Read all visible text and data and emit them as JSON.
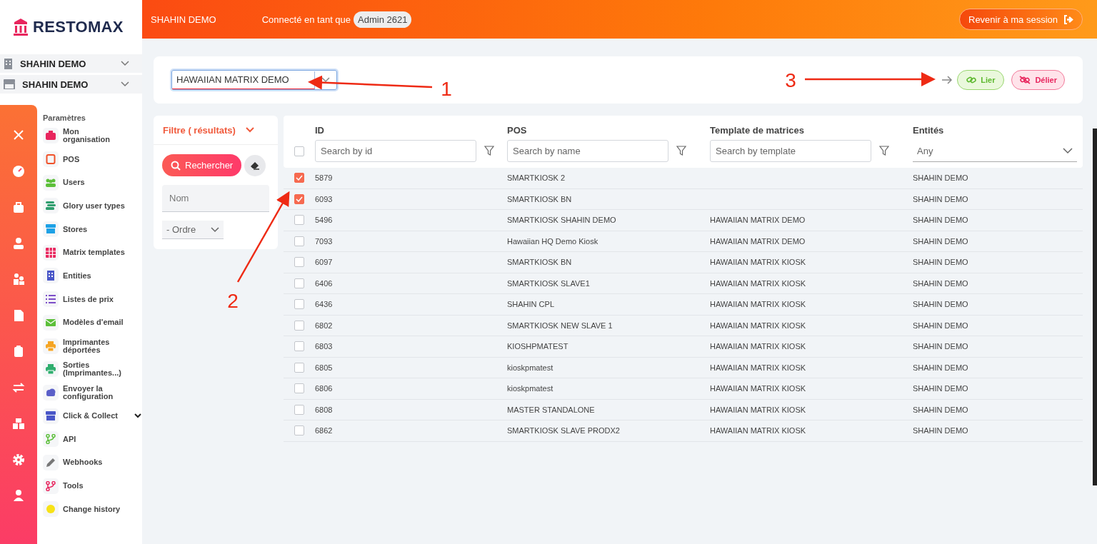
{
  "brand": {
    "name": "RESTOMAX"
  },
  "header": {
    "org": "SHAHIN DEMO",
    "connected_label": "Connecté en tant que",
    "user": "Admin 2621",
    "return_button": "Revenir à ma session"
  },
  "org_selectors": [
    {
      "kind": "building",
      "label": "SHAHIN DEMO"
    },
    {
      "kind": "store",
      "label": "SHAHIN DEMO"
    }
  ],
  "rail": [
    {
      "kind": "close"
    },
    {
      "kind": "gauge"
    },
    {
      "kind": "bag"
    },
    {
      "kind": "person"
    },
    {
      "kind": "people"
    },
    {
      "kind": "document"
    },
    {
      "kind": "clipboard"
    },
    {
      "kind": "swap"
    },
    {
      "kind": "boxes"
    },
    {
      "kind": "gear"
    },
    {
      "kind": "user"
    }
  ],
  "menu": {
    "title": "Paramètres",
    "items": [
      {
        "kind": "briefcase",
        "label": "Mon organisation",
        "color": "#e8265e"
      },
      {
        "kind": "tablet",
        "label": "POS",
        "color": "#f0522a"
      },
      {
        "kind": "people",
        "label": "Users",
        "color": "#5cbf3a"
      },
      {
        "kind": "coins",
        "label": "Glory user types",
        "color": "#2f9e6e"
      },
      {
        "kind": "store",
        "label": "Stores",
        "color": "#1da1e6"
      },
      {
        "kind": "grid",
        "label": "Matrix templates",
        "color": "#e8265e"
      },
      {
        "kind": "building",
        "label": "Entities",
        "color": "#4a57c8"
      },
      {
        "kind": "list",
        "label": "Listes de prix",
        "color": "#7c4dc8"
      },
      {
        "kind": "envelope",
        "label": "Modèles d'email",
        "color": "#5cbf3a"
      },
      {
        "kind": "printer",
        "label": "Imprimantes déportées",
        "color": "#f5a524"
      },
      {
        "kind": "printer",
        "label": "Sorties (Imprimantes...)",
        "color": "#2fae6e"
      },
      {
        "kind": "cloud",
        "label": "Envoyer la configuration",
        "color": "#5a5fc8"
      },
      {
        "kind": "store",
        "label": "Click & Collect",
        "color": "#4a57c8",
        "expandable": true
      },
      {
        "kind": "branch",
        "label": "API",
        "color": "#5cbf3a"
      },
      {
        "kind": "pencil",
        "label": "Webhooks",
        "color": "#777777"
      },
      {
        "kind": "branch",
        "label": "Tools",
        "color": "#e8265e"
      },
      {
        "kind": "dot",
        "label": "Change history",
        "color": "#f7e217"
      }
    ]
  },
  "template_select": {
    "value": "HAWAIIAN MATRIX DEMO"
  },
  "actions": {
    "link": "Lier",
    "unlink": "Délier"
  },
  "filter": {
    "title": "Filtre ( résultats)",
    "search_button": "Rechercher",
    "name_placeholder": "Nom",
    "order": "- Ordre"
  },
  "table": {
    "columns": [
      "ID",
      "POS",
      "Template de matrices",
      "Entités"
    ],
    "filters": [
      {
        "placeholder": "Search by id"
      },
      {
        "placeholder": "Search by name"
      },
      {
        "placeholder": "Search by template"
      },
      {
        "value": "Any"
      }
    ],
    "all_selected": false,
    "rows": [
      {
        "selected": true,
        "id": "5879",
        "pos": "SMARTKIOSK 2",
        "template": "",
        "entity": "SHAHIN DEMO"
      },
      {
        "selected": true,
        "id": "6093",
        "pos": "SMARTKIOSK BN",
        "template": "",
        "entity": "SHAHIN DEMO"
      },
      {
        "selected": false,
        "id": "5496",
        "pos": "SMARTKIOSK SHAHIN DEMO",
        "template": "HAWAIIAN MATRIX DEMO",
        "entity": "SHAHIN DEMO"
      },
      {
        "selected": false,
        "id": "7093",
        "pos": "Hawaiian HQ Demo Kiosk",
        "template": "HAWAIIAN MATRIX DEMO",
        "entity": "SHAHIN DEMO"
      },
      {
        "selected": false,
        "id": "6097",
        "pos": "SMARTKIOSK BN",
        "template": "HAWAIIAN MATRIX KIOSK",
        "entity": "SHAHIN DEMO"
      },
      {
        "selected": false,
        "id": "6406",
        "pos": "SMARTKIOSK SLAVE1",
        "template": "HAWAIIAN MATRIX KIOSK",
        "entity": "SHAHIN DEMO"
      },
      {
        "selected": false,
        "id": "6436",
        "pos": "SHAHIN CPL",
        "template": "HAWAIIAN MATRIX KIOSK",
        "entity": "SHAHIN DEMO"
      },
      {
        "selected": false,
        "id": "6802",
        "pos": "SMARTKIOSK NEW SLAVE 1",
        "template": "HAWAIIAN MATRIX KIOSK",
        "entity": "SHAHIN DEMO"
      },
      {
        "selected": false,
        "id": "6803",
        "pos": "KIOSHPMATEST",
        "template": "HAWAIIAN MATRIX KIOSK",
        "entity": "SHAHIN DEMO"
      },
      {
        "selected": false,
        "id": "6805",
        "pos": "kioskpmatest",
        "template": "HAWAIIAN MATRIX KIOSK",
        "entity": "SHAHIN DEMO"
      },
      {
        "selected": false,
        "id": "6806",
        "pos": "kioskpmatest",
        "template": "HAWAIIAN MATRIX KIOSK",
        "entity": "SHAHIN DEMO"
      },
      {
        "selected": false,
        "id": "6808",
        "pos": "MASTER STANDALONE",
        "template": "HAWAIIAN MATRIX KIOSK",
        "entity": "SHAHIN DEMO"
      },
      {
        "selected": false,
        "id": "6862",
        "pos": "SMARTKIOSK SLAVE PRODX2",
        "template": "HAWAIIAN MATRIX KIOSK",
        "entity": "SHAHIN DEMO"
      }
    ]
  },
  "annotations": [
    {
      "label": "1"
    },
    {
      "label": "2"
    },
    {
      "label": "3"
    }
  ]
}
